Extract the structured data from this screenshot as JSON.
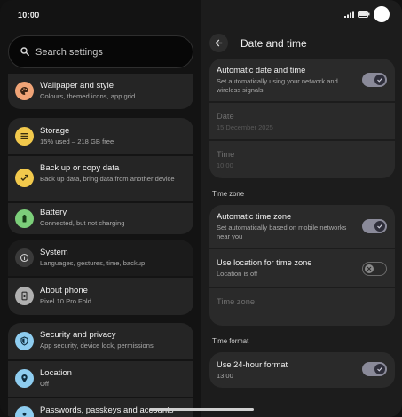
{
  "status_bar": {
    "time": "10:00"
  },
  "search": {
    "placeholder": "Search settings"
  },
  "settings_list": [
    {
      "key": "wallpaper",
      "title": "Wallpaper and style",
      "subtitle": "Colours, themed icons, app grid",
      "icon": "palette-icon",
      "icon_color": "#f0a477"
    },
    {
      "key": "storage",
      "title": "Storage",
      "subtitle": "15% used – 218 GB free",
      "icon": "storage-icon",
      "icon_color": "#f2c94c"
    },
    {
      "key": "backup",
      "title": "Back up or copy data",
      "subtitle": "Back up data, bring data from another device",
      "icon": "sync-icon",
      "icon_color": "#f2c94c"
    },
    {
      "key": "battery",
      "title": "Battery",
      "subtitle": "Connected, but not charging",
      "icon": "battery-icon",
      "icon_color": "#7ccf7a"
    },
    {
      "key": "system",
      "title": "System",
      "subtitle": "Languages, gestures, time, backup",
      "icon": "info-icon",
      "icon_color": "#b0b0b0"
    },
    {
      "key": "about",
      "title": "About phone",
      "subtitle": "Pixel 10 Pro Fold",
      "icon": "phone-icon",
      "icon_color": "#b0b0b0"
    },
    {
      "key": "security",
      "title": "Security and privacy",
      "subtitle": "App security, device lock, permissions",
      "icon": "shield-icon",
      "icon_color": "#8ecdf0"
    },
    {
      "key": "location",
      "title": "Location",
      "subtitle": "Off",
      "icon": "location-pin-icon",
      "icon_color": "#8ecdf0"
    },
    {
      "key": "passwords",
      "title": "Passwords, passkeys and accounts",
      "subtitle": "",
      "icon": "person-icon",
      "icon_color": "#8ecdf0"
    }
  ],
  "detail": {
    "title": "Date and time",
    "auto_datetime": {
      "title": "Automatic date and time",
      "subtitle": "Set automatically using your network and wireless signals",
      "enabled": true
    },
    "date": {
      "title": "Date",
      "value": "15 December 2025"
    },
    "time": {
      "title": "Time",
      "value": "10:00"
    },
    "section_timezone": "Time zone",
    "auto_timezone": {
      "title": "Automatic time zone",
      "subtitle": "Set automatically based on mobile networks near you",
      "enabled": true
    },
    "use_location": {
      "title": "Use location for time zone",
      "subtitle": "Location is off",
      "enabled": false
    },
    "time_zone": {
      "title": "Time zone"
    },
    "section_format": "Time format",
    "use_24h": {
      "title": "Use 24-hour format",
      "subtitle": "13:00",
      "enabled": true
    }
  },
  "colors": {
    "toggle_on": "#8a8a99",
    "card": "#252525",
    "background": "#131313"
  }
}
